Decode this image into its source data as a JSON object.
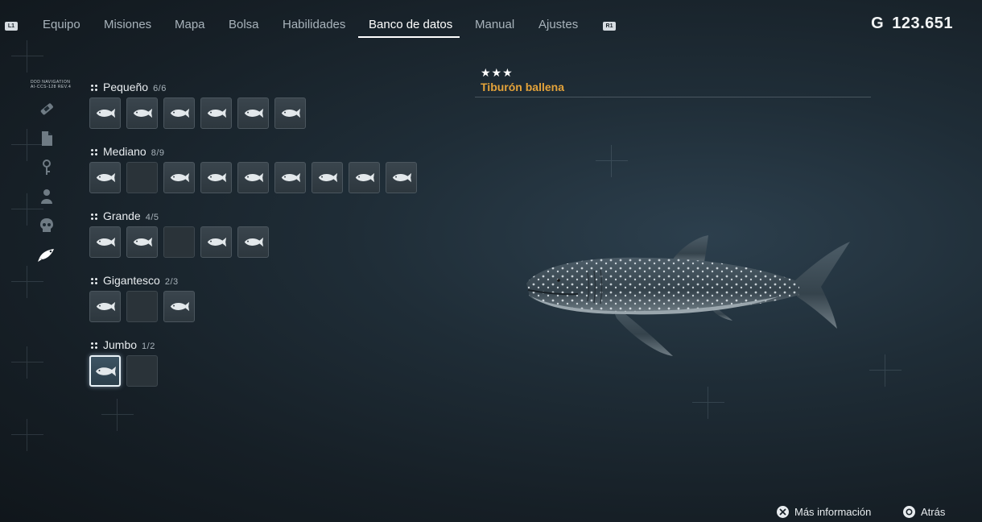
{
  "header": {
    "left_shoulder": "L1",
    "right_shoulder": "R1",
    "tabs": [
      {
        "label": "Equipo"
      },
      {
        "label": "Misiones"
      },
      {
        "label": "Mapa"
      },
      {
        "label": "Bolsa"
      },
      {
        "label": "Habilidades"
      },
      {
        "label": "Banco de datos",
        "active": true
      },
      {
        "label": "Manual"
      },
      {
        "label": "Ajustes"
      }
    ],
    "currency_symbol": "G",
    "currency_value": "123.651"
  },
  "sidenav": {
    "label": "DDD NAVIGATION\nAI-CCS-128 REV.4",
    "items": [
      {
        "icon": "bandage-icon"
      },
      {
        "icon": "document-icon"
      },
      {
        "icon": "key-icon"
      },
      {
        "icon": "person-icon"
      },
      {
        "icon": "skull-icon"
      },
      {
        "icon": "fish-icon",
        "active": true
      }
    ]
  },
  "categories": [
    {
      "name": "Pequeño",
      "count": "6/6",
      "slots": [
        "filled",
        "filled",
        "filled",
        "filled",
        "filled",
        "filled"
      ]
    },
    {
      "name": "Mediano",
      "count": "8/9",
      "slots": [
        "filled",
        "empty",
        "filled",
        "filled",
        "filled",
        "filled",
        "filled",
        "filled",
        "filled"
      ]
    },
    {
      "name": "Grande",
      "count": "4/5",
      "slots": [
        "filled",
        "filled",
        "empty",
        "filled",
        "filled"
      ]
    },
    {
      "name": "Gigantesco",
      "count": "2/3",
      "slots": [
        "filled",
        "empty",
        "filled"
      ]
    },
    {
      "name": "Jumbo",
      "count": "1/2",
      "slots": [
        "selected",
        "empty"
      ]
    }
  ],
  "detail": {
    "stars": "★★★",
    "name": "Tiburón ballena",
    "image": "whale-shark-image"
  },
  "footer": {
    "more_info": "Más información",
    "back": "Atrás"
  },
  "colors": {
    "accent_name": "#e4a33a",
    "active_tab": "#ffffff",
    "inactive_tab": "#a8b3bb"
  }
}
